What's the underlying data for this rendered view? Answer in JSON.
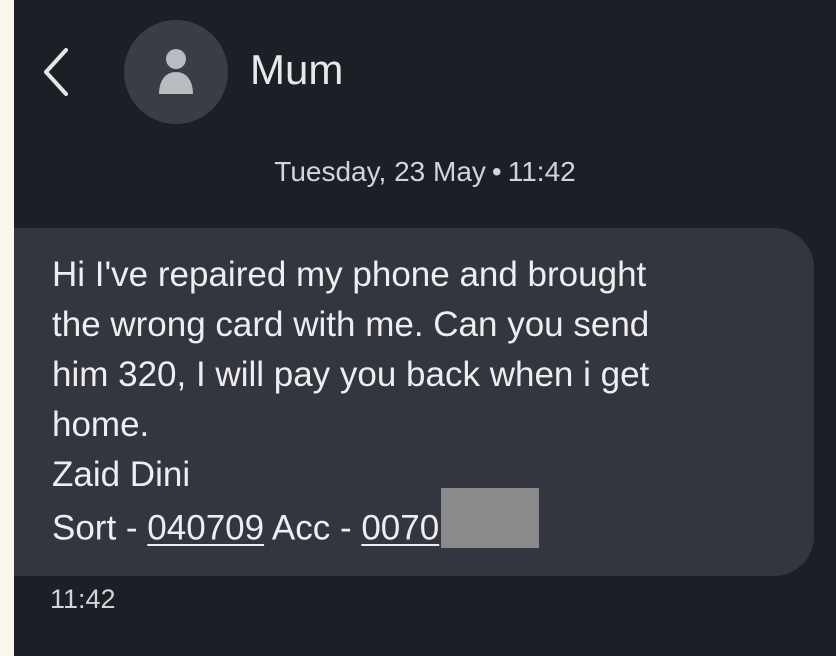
{
  "header": {
    "back_icon": "chevron-left-icon",
    "avatar_icon": "person-icon",
    "contact_name": "Mum"
  },
  "conversation": {
    "date_label": "Tuesday, 23 May",
    "separator": "•",
    "date_time": "11:42"
  },
  "message": {
    "lines": [
      "Hi I've repaired my phone and brought",
      "the wrong card with me. Can you send",
      "him 320, I will pay you back when i get",
      "home.",
      "Zaid Dini"
    ],
    "sort_label": "Sort - ",
    "sort_code": "040709",
    "acc_label": " Acc - ",
    "acc_number_visible": "0070",
    "timestamp": "11:42"
  },
  "colors": {
    "page_border": "#fbf6ec",
    "background": "#1c1f26",
    "bubble": "#33363e",
    "text": "#eeeef0",
    "redaction": "#8a8a8c"
  }
}
